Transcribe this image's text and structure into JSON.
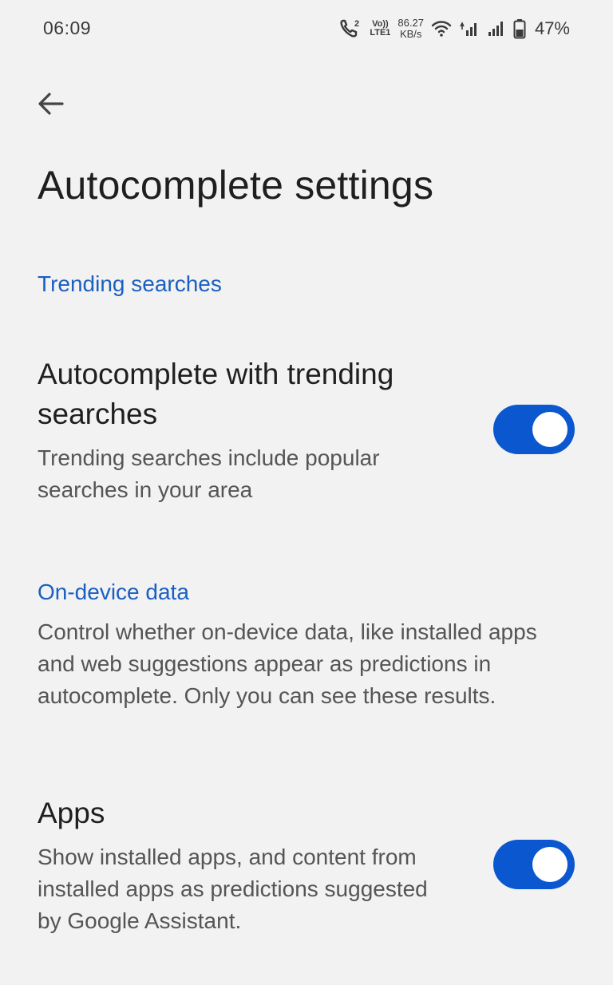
{
  "status_bar": {
    "time": "06:09",
    "volte_top": "Vo))",
    "volte_bottom": "LTE1",
    "net_speed_value": "86.27",
    "net_speed_unit": "KB/s",
    "battery_percent": "47%",
    "icons": [
      "call-icon",
      "volte-icon",
      "wifi-icon",
      "signal-icon",
      "signal-icon",
      "battery-icon"
    ]
  },
  "header": {
    "back_icon": "back-arrow-icon",
    "title": "Autocomplete settings"
  },
  "sections": {
    "trending": {
      "header": "Trending searches",
      "setting": {
        "title": "Autocomplete with trending searches",
        "description": "Trending searches include popular searches in your area",
        "enabled": true
      }
    },
    "on_device": {
      "header": "On-device data",
      "description": "Control whether on-device data, like installed apps and web suggestions appear as predictions in autocomplete. Only you can see these results.",
      "setting": {
        "title": "Apps",
        "description": "Show installed apps, and content from installed apps as predictions suggested by Google Assistant.",
        "enabled": true
      }
    }
  },
  "colors": {
    "accent": "#0b57d0",
    "section_header": "#1a5fc1",
    "background": "#f2f2f2"
  }
}
